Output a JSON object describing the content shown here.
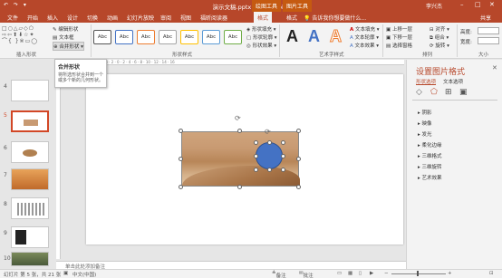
{
  "titlebar": {
    "title": "演示文稿.pptx - PowerPoint",
    "ctx_drawing": "绘图工具",
    "ctx_picture": "图片工具",
    "user": "李兴杰",
    "qat": "↶ ↷ ▾"
  },
  "tabs": [
    "文件",
    "开始",
    "插入",
    "设计",
    "切换",
    "动画",
    "幻灯片放映",
    "审阅",
    "视图",
    "福昕阅读器",
    "格式",
    "格式"
  ],
  "active_tab_index": 10,
  "tellme": "告诉我你想要做什么...",
  "share": "共享",
  "ribbon": {
    "insert_shapes": {
      "edit_shape": "编辑形状",
      "textbox": "文本框",
      "merge_shapes": "合并形状",
      "label": "插入形状"
    },
    "shape_styles": {
      "swatch": "Abc",
      "fill": "形状填充",
      "outline": "形状轮廓",
      "effects": "形状效果",
      "label": "形状样式",
      "colors": [
        "#ffffff",
        "#4472c4",
        "#ed7d31",
        "#a5a5a5",
        "#ffc000",
        "#5b9bd5",
        "#70ad47"
      ]
    },
    "wordart": {
      "letter": "A",
      "fill": "文本填充",
      "outline": "文本轮廓",
      "effects": "文本效果",
      "label": "艺术字样式"
    },
    "arrange": {
      "bring_forward": "上移一层",
      "send_backward": "下移一层",
      "selection_pane": "选择窗格",
      "align": "对齐",
      "group": "组合",
      "rotate": "旋转",
      "label": "排列"
    },
    "size": {
      "height_label": "高度:",
      "width_label": "宽度:",
      "label": "大小"
    }
  },
  "tooltip": {
    "title": "合并形状",
    "desc": "将所选形状合并到一个或多个新的几何形状。"
  },
  "slides": [
    {
      "num": "4",
      "selected": false
    },
    {
      "num": "5",
      "selected": true
    },
    {
      "num": "6",
      "selected": false
    },
    {
      "num": "7",
      "selected": false
    },
    {
      "num": "8",
      "selected": false
    },
    {
      "num": "9",
      "selected": false
    },
    {
      "num": "10",
      "selected": false
    }
  ],
  "notes_placeholder": "单击此处添加备注",
  "format_pane": {
    "title": "设置图片格式",
    "tab_shape": "形状选项",
    "tab_text": "文本选项",
    "sections": [
      "阴影",
      "映像",
      "发光",
      "柔化边缘",
      "三维格式",
      "三维旋转",
      "艺术效果"
    ]
  },
  "status": {
    "slide_info": "幻灯片 第 5 张，共 21 张",
    "language": "中文(中国)",
    "notes": "备注",
    "comments": "批注"
  }
}
